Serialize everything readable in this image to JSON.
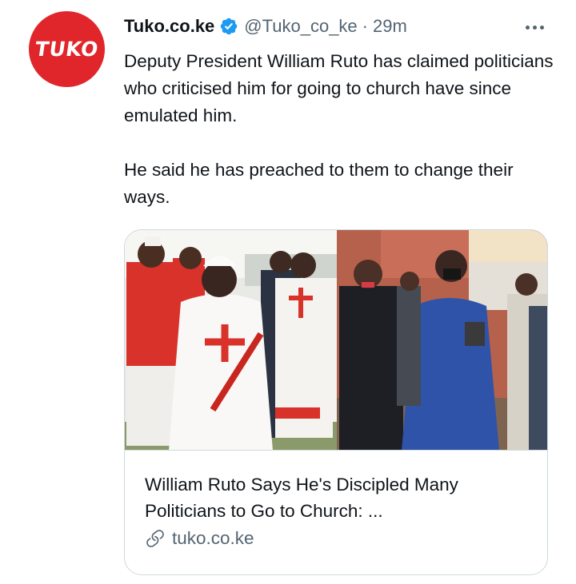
{
  "tweet": {
    "avatar_text": "TUKO",
    "display_name": "Tuko.co.ke",
    "handle": "@Tuko_co_ke",
    "separator": "·",
    "time": "29m",
    "paragraphs": [
      "Deputy President William Ruto has claimed politicians who criticised him for going to church have since emulated him.",
      "He said he has preached to them to change their ways."
    ]
  },
  "card": {
    "title_line1": "William Ruto Says He's Discipled Many",
    "title_line2": "Politicians to Go to Church: ...",
    "domain": "tuko.co.ke"
  },
  "colors": {
    "brand_red": "#e0262b",
    "verified_blue": "#1d9bf0",
    "secondary_text": "#536471",
    "border": "#cfd9de"
  },
  "icons": [
    "verified-badge-icon",
    "more-options-icon",
    "link-icon"
  ]
}
